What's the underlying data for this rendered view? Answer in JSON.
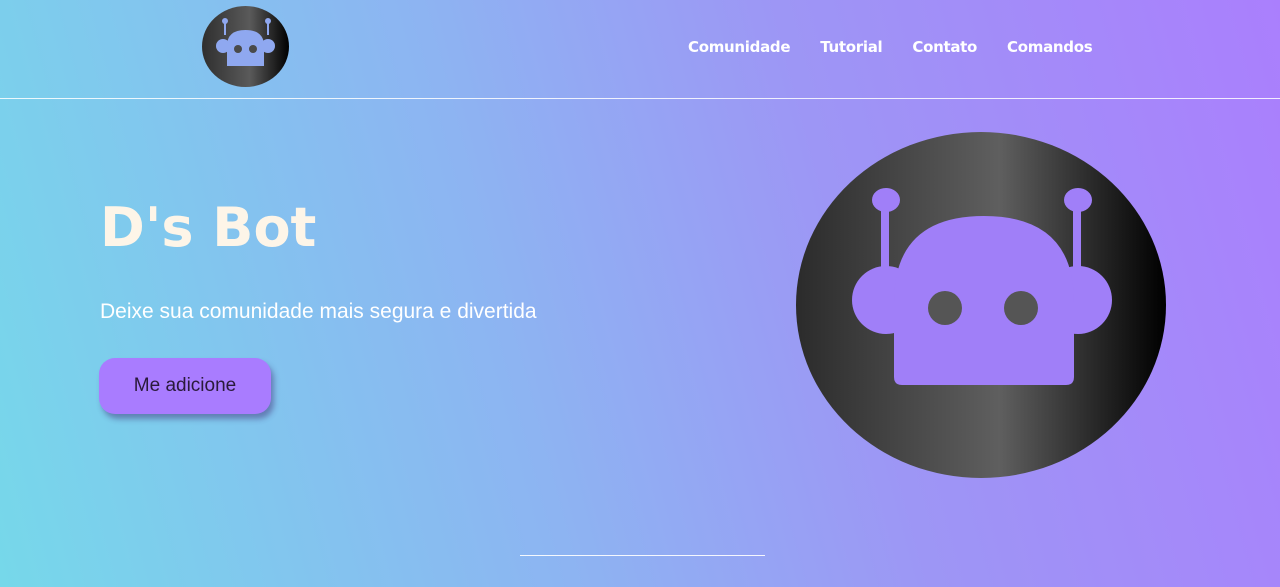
{
  "nav": {
    "items": [
      {
        "label": "Comunidade"
      },
      {
        "label": "Tutorial"
      },
      {
        "label": "Contato"
      },
      {
        "label": "Comandos"
      }
    ]
  },
  "hero": {
    "title": "D's Bot",
    "subtitle": "Deixe sua comunidade mais segura e divertida",
    "cta_label": "Me adicione"
  },
  "icons": {
    "logo": "robot-icon",
    "hero_image": "robot-icon"
  },
  "colors": {
    "gradient_start": "#76d8ea",
    "gradient_end": "#aa7ffd",
    "accent": "#a97cff",
    "robot_fill": "#a07ff8",
    "title_color": "#fdf5e8"
  }
}
